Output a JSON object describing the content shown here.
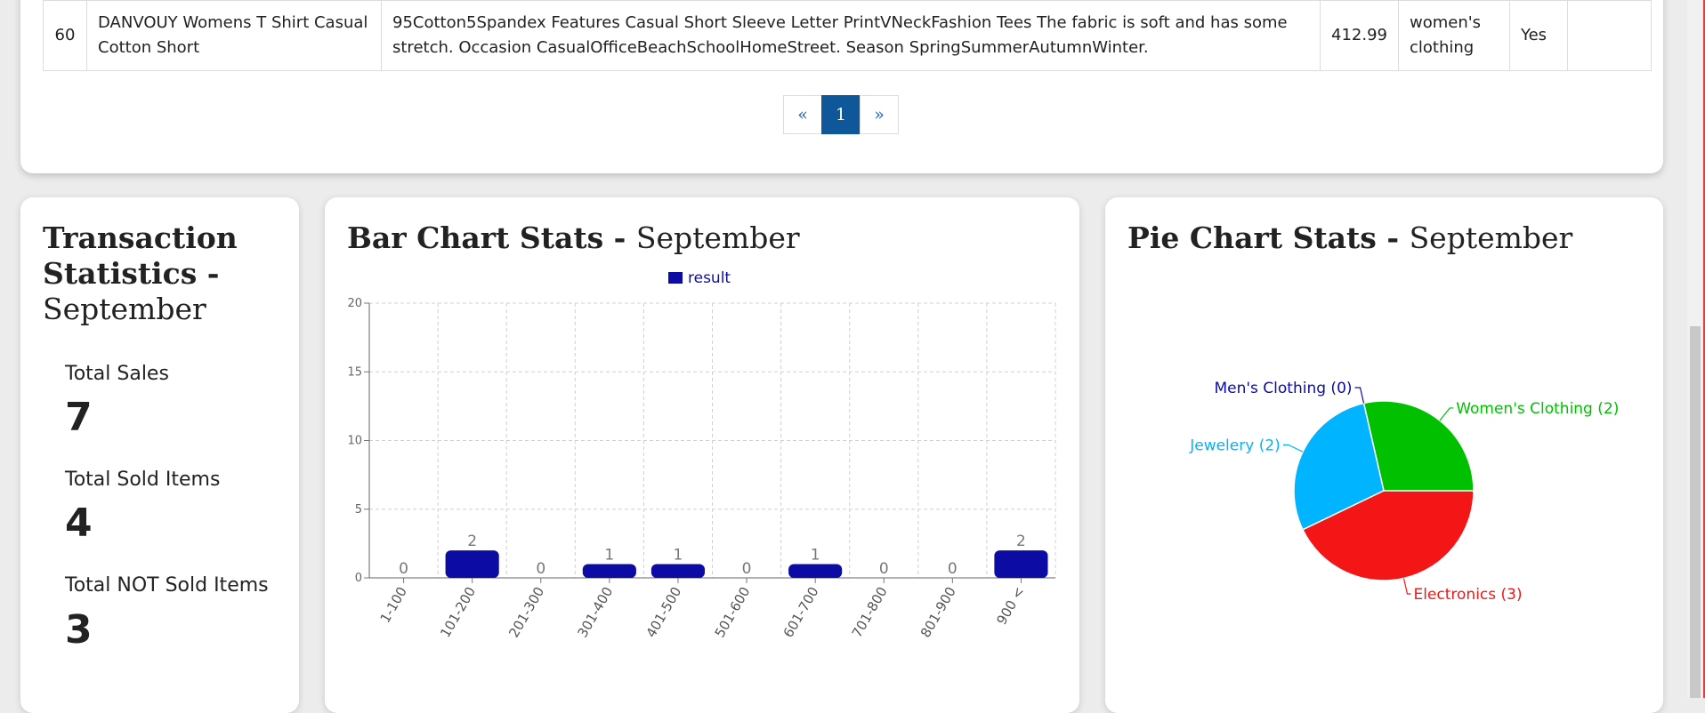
{
  "product_row": {
    "id": "60",
    "title": "DANVOUY Womens T Shirt Casual Cotton Short",
    "description": "95Cotton5Spandex Features Casual Short Sleeve Letter PrintVNeckFashion Tees The fabric is soft and has some stretch. Occasion CasualOfficeBeachSchoolHomeStreet. Season SpringSummerAutumnWinter.",
    "price": "412.99",
    "category": "women's clothing",
    "sold": "Yes",
    "image": ""
  },
  "pagination": {
    "prev": "«",
    "current": "1",
    "next": "»"
  },
  "transactions": {
    "title_bold": "Transaction Statistics -",
    "month": "September",
    "total_sales_label": "Total Sales",
    "total_sales": "7",
    "sold_label": "Total Sold Items",
    "sold": "4",
    "not_sold_label": "Total NOT Sold Items",
    "not_sold": "3"
  },
  "bar_card": {
    "title_bold": "Bar Chart Stats -",
    "month": "September"
  },
  "pie_card": {
    "title_bold": "Pie Chart Stats -",
    "month": "September"
  },
  "chart_data": [
    {
      "type": "bar",
      "legend": [
        "result"
      ],
      "categories": [
        "1-100",
        "101-200",
        "201-300",
        "301-400",
        "401-500",
        "501-600",
        "601-700",
        "701-800",
        "801-900",
        "900 <"
      ],
      "series": [
        {
          "name": "result",
          "values": [
            0,
            2,
            0,
            1,
            1,
            0,
            1,
            0,
            0,
            2
          ],
          "color": "#0c0ca5"
        }
      ],
      "ylim": [
        0,
        20
      ],
      "yticks": [
        0,
        5,
        10,
        15,
        20
      ],
      "grid": true,
      "legend_position": "top-center"
    },
    {
      "type": "pie",
      "slices": [
        {
          "label": "Women's Clothing (2)",
          "value": 2,
          "color": "#00c000"
        },
        {
          "label": "Men's Clothing (0)",
          "value": 0,
          "color": "#0c0ca5"
        },
        {
          "label": "Jewelery (2)",
          "value": 2,
          "color": "#00b4ff"
        },
        {
          "label": "Electronics (3)",
          "value": 3,
          "color": "#f41616"
        }
      ]
    }
  ]
}
